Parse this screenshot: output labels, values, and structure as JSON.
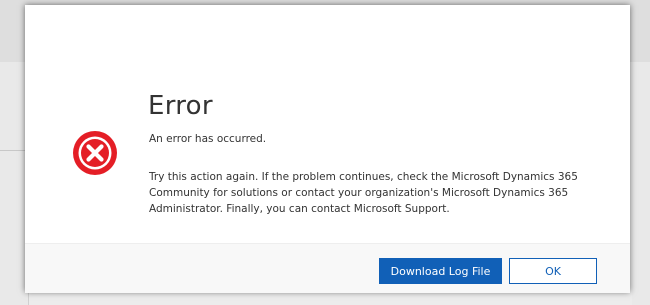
{
  "dialog": {
    "title": "Error",
    "subtitle": "An error has occurred.",
    "message": "Try this action again. If the problem continues, check the Microsoft Dynamics 365 Community for solutions or contact your organization's Microsoft Dynamics 365 Administrator. Finally, you can contact Microsoft Support.",
    "icon": "error-x-circle-icon",
    "buttons": {
      "download_label": "Download Log File",
      "ok_label": "OK"
    }
  },
  "colors": {
    "error_icon": "#e41e26",
    "primary_button": "#1160b7",
    "dialog_footer": "#f8f8f8",
    "text": "#333333"
  }
}
